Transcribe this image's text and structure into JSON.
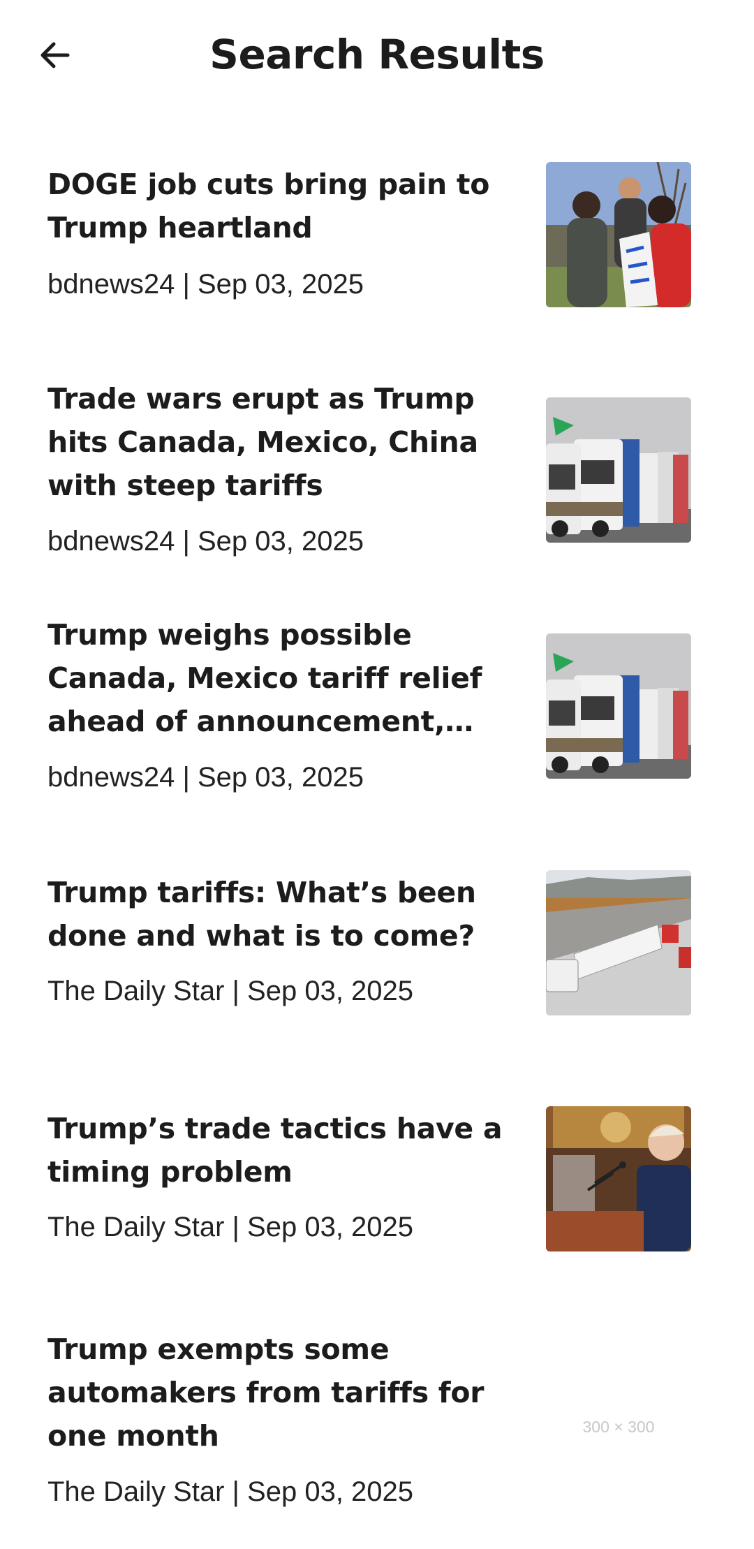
{
  "header": {
    "title": "Search Results",
    "back_icon": "arrow-left-icon"
  },
  "articles": [
    {
      "title": "DOGE job cuts bring pain to Trump heartland",
      "meta": "bdnews24 | Sep 03, 2025",
      "image": "protest-photo"
    },
    {
      "title": "Trade wars erupt as Trump hits Canada, Mexico, China with steep tariffs",
      "meta": "bdnews24 | Sep 03, 2025",
      "image": "trucks-photo"
    },
    {
      "title": "Trump weighs possible Canada, Mexico tariff relief ahead of announcement, Commerce Secretary says",
      "meta": "bdnews24 | Sep 03, 2025",
      "image": "trucks-photo"
    },
    {
      "title": "Trump tariffs: What’s been done and what is to come?",
      "meta": "The Daily Star | Sep 03, 2025",
      "image": "border-trucks-photo"
    },
    {
      "title": "Trump’s trade tactics have a timing problem",
      "meta": "The Daily Star | Sep 03, 2025",
      "image": "podium-speech-photo"
    },
    {
      "title": "Trump exempts some automakers from tariffs for one month",
      "meta": "The Daily Star | Sep 03, 2025",
      "image": "placeholder",
      "placeholder_text": "300 × 300"
    }
  ]
}
